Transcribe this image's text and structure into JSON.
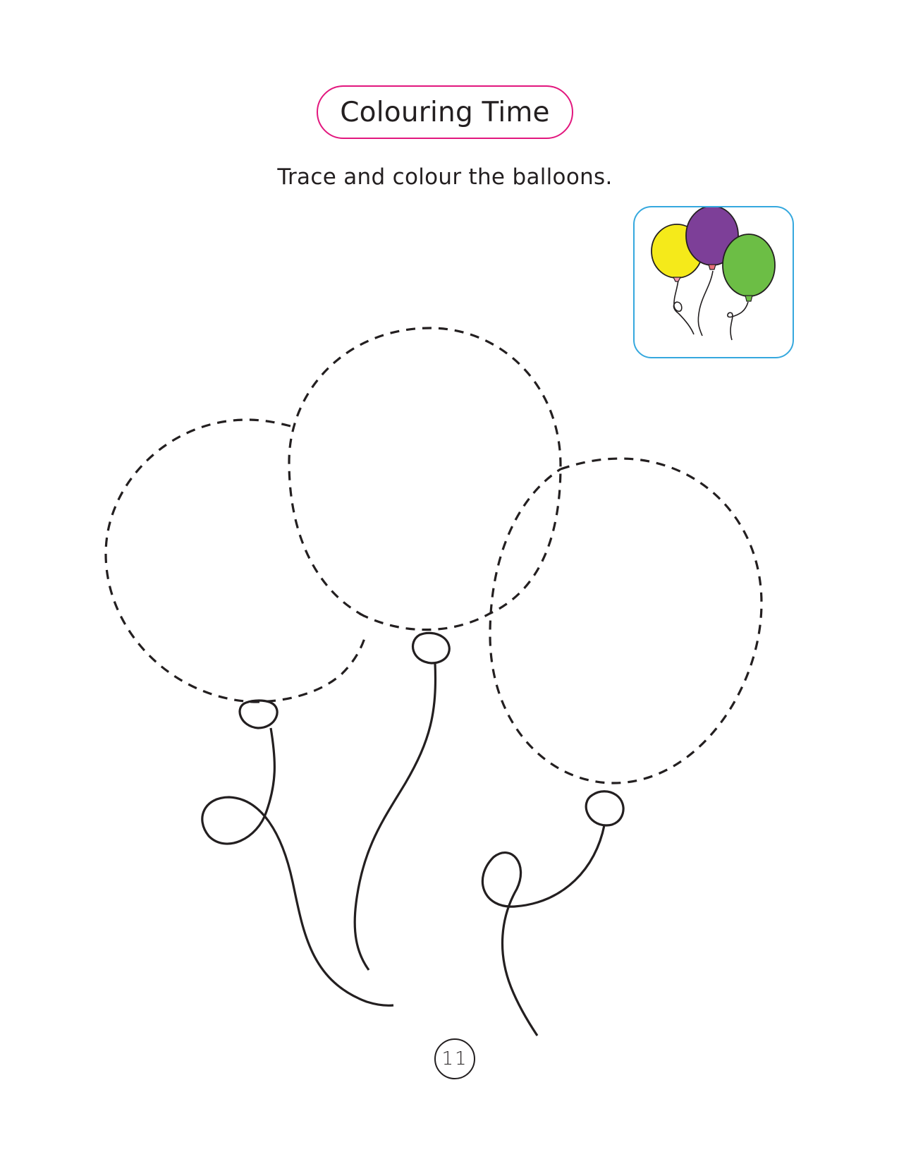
{
  "header": {
    "title": "Colouring Time",
    "instruction": "Trace and colour the balloons."
  },
  "reference_picture": {
    "icon": "colored-balloons-icon",
    "balloon_colors": [
      "#f5ea1a",
      "#7d3f98",
      "#6cbe45"
    ]
  },
  "tracing": {
    "balloon_count": 3,
    "outline_style": "dashed",
    "icon": "balloon-outline-icon"
  },
  "footer": {
    "page_number": "11"
  },
  "colors": {
    "title_border": "#e2177e",
    "reference_border": "#35a8de",
    "ink": "#231f20"
  }
}
